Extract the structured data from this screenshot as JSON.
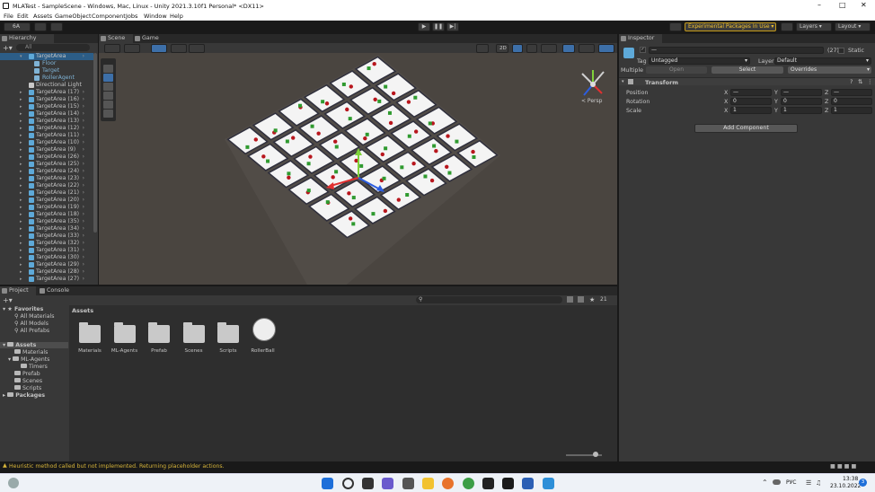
{
  "window": {
    "title": "MLATest - SampleScene - Windows, Mac, Linux - Unity 2021.3.10f1 Personal* <DX11>"
  },
  "menu": [
    "File",
    "Edit",
    "Assets",
    "GameObject",
    "Component",
    "Jobs",
    "Window",
    "Help"
  ],
  "toolbar": {
    "account": "6A",
    "packages": "Experimental Packages In Use",
    "layers": "Layers",
    "layout": "Layout"
  },
  "hierarchy": {
    "tab": "Hierarchy",
    "search_placeholder": "All",
    "expanded": {
      "name": "TargetArea",
      "children": [
        "Floor",
        "Target",
        "RollerAgent"
      ]
    },
    "light": "Directional Light",
    "items": [
      "TargetArea (17)",
      "TargetArea (16)",
      "TargetArea (15)",
      "TargetArea (14)",
      "TargetArea (13)",
      "TargetArea (12)",
      "TargetArea (11)",
      "TargetArea (10)",
      "TargetArea (9)",
      "TargetArea (26)",
      "TargetArea (25)",
      "TargetArea (24)",
      "TargetArea (23)",
      "TargetArea (22)",
      "TargetArea (21)",
      "TargetArea (20)",
      "TargetArea (19)",
      "TargetArea (18)",
      "TargetArea (35)",
      "TargetArea (34)",
      "TargetArea (33)",
      "TargetArea (32)",
      "TargetArea (31)",
      "TargetArea (30)",
      "TargetArea (29)",
      "TargetArea (28)",
      "TargetArea (27)"
    ]
  },
  "scene": {
    "tabs": [
      "Scene",
      "Game"
    ],
    "mode2d": "2D",
    "persp": "< Persp"
  },
  "inspector": {
    "tab": "Inspector",
    "count": "(27)",
    "static": "Static",
    "tag_label": "Tag",
    "tag_value": "Untagged",
    "layer_label": "Layer",
    "layer_value": "Default",
    "multiple": "Multiple",
    "open": "Open",
    "select": "Select",
    "overrides": "Overrides",
    "component": "Transform",
    "rows": [
      {
        "label": "Position",
        "x": "—",
        "y": "—",
        "z": "—"
      },
      {
        "label": "Rotation",
        "x": "0",
        "y": "0",
        "z": "0"
      },
      {
        "label": "Scale",
        "x": "1",
        "y": "1",
        "z": "1"
      }
    ],
    "add_component": "Add Component"
  },
  "project": {
    "tabs": [
      "Project",
      "Console"
    ],
    "count": "21",
    "favorites": {
      "label": "Favorites",
      "items": [
        "All Materials",
        "All Models",
        "All Prefabs"
      ]
    },
    "assets_tree": {
      "label": "Assets",
      "items": [
        "Materials",
        "ML-Agents",
        "Timers",
        "Prefab",
        "Scenes",
        "Scripts"
      ]
    },
    "packages": "Packages",
    "breadcrumb": "Assets",
    "assets": [
      "Materials",
      "ML-Agents",
      "Prefab",
      "Scenes",
      "Scripts",
      "RollerBall"
    ]
  },
  "status": {
    "message": "Heuristic method called but not implemented. Returning placeholder actions."
  },
  "taskbar": {
    "lang": "РУС",
    "time": "13:38",
    "date": "23.10.2022",
    "badge": "3"
  }
}
